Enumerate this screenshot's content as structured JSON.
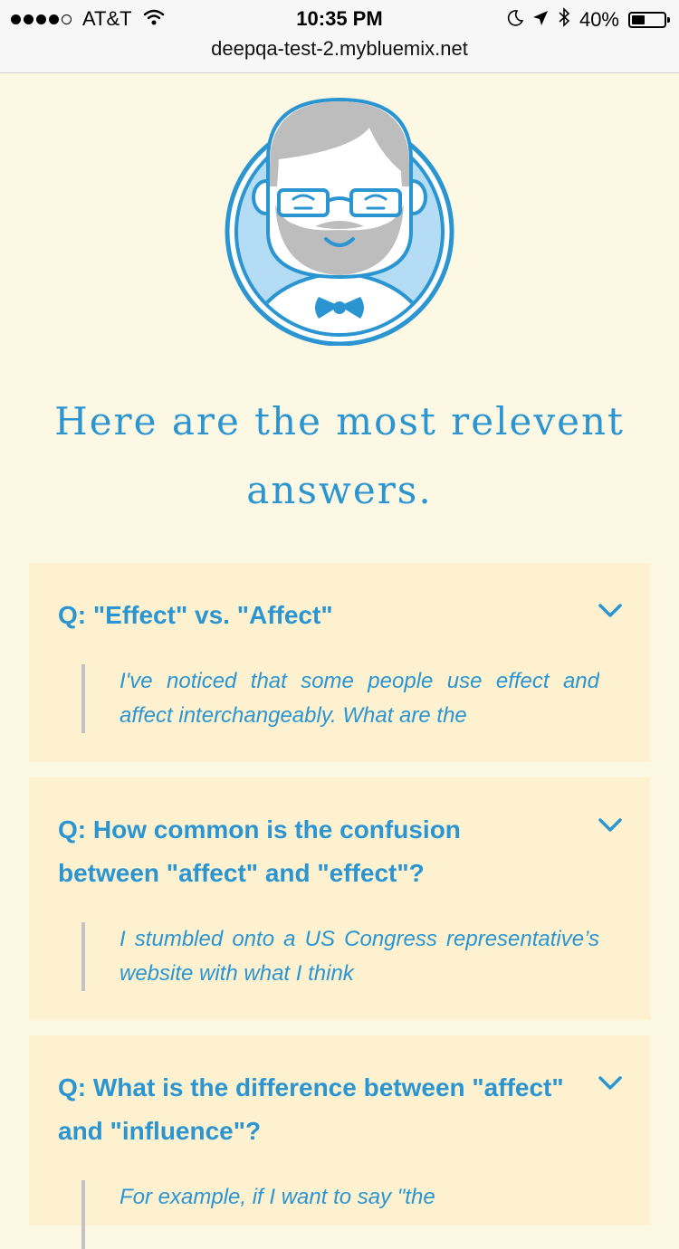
{
  "status_bar": {
    "carrier": "AT&T",
    "time": "10:35 PM",
    "battery": "40%",
    "battery_level": 0.4,
    "signal_bars_filled": 4,
    "signal_bars_total": 5
  },
  "browser": {
    "url": "deepqa-test-2.mybluemix.net"
  },
  "heading": "Here are the most relevent answers.",
  "colors": {
    "accent": "#2b95d2",
    "page_bg": "#fdf8e4",
    "card_bg": "#fdf1d0",
    "quote_rule": "#c3c3c3"
  },
  "answers": [
    {
      "question": "Q: \"Effect\" vs. \"Affect\"",
      "excerpt": "I've noticed that some people use effect and affect interchangeably. What are the",
      "toggle_icon": "chevron-down-icon"
    },
    {
      "question": "Q: How common is the confusion between \"affect\" and \"effect\"?",
      "excerpt": "I stumbled onto a US Congress representative’s website with what I think",
      "toggle_icon": "chevron-down-icon"
    },
    {
      "question": "Q: What is the difference between \"affect\" and \"influence\"?",
      "excerpt": "For example, if I want to say \"the",
      "toggle_icon": "chevron-down-icon"
    }
  ]
}
